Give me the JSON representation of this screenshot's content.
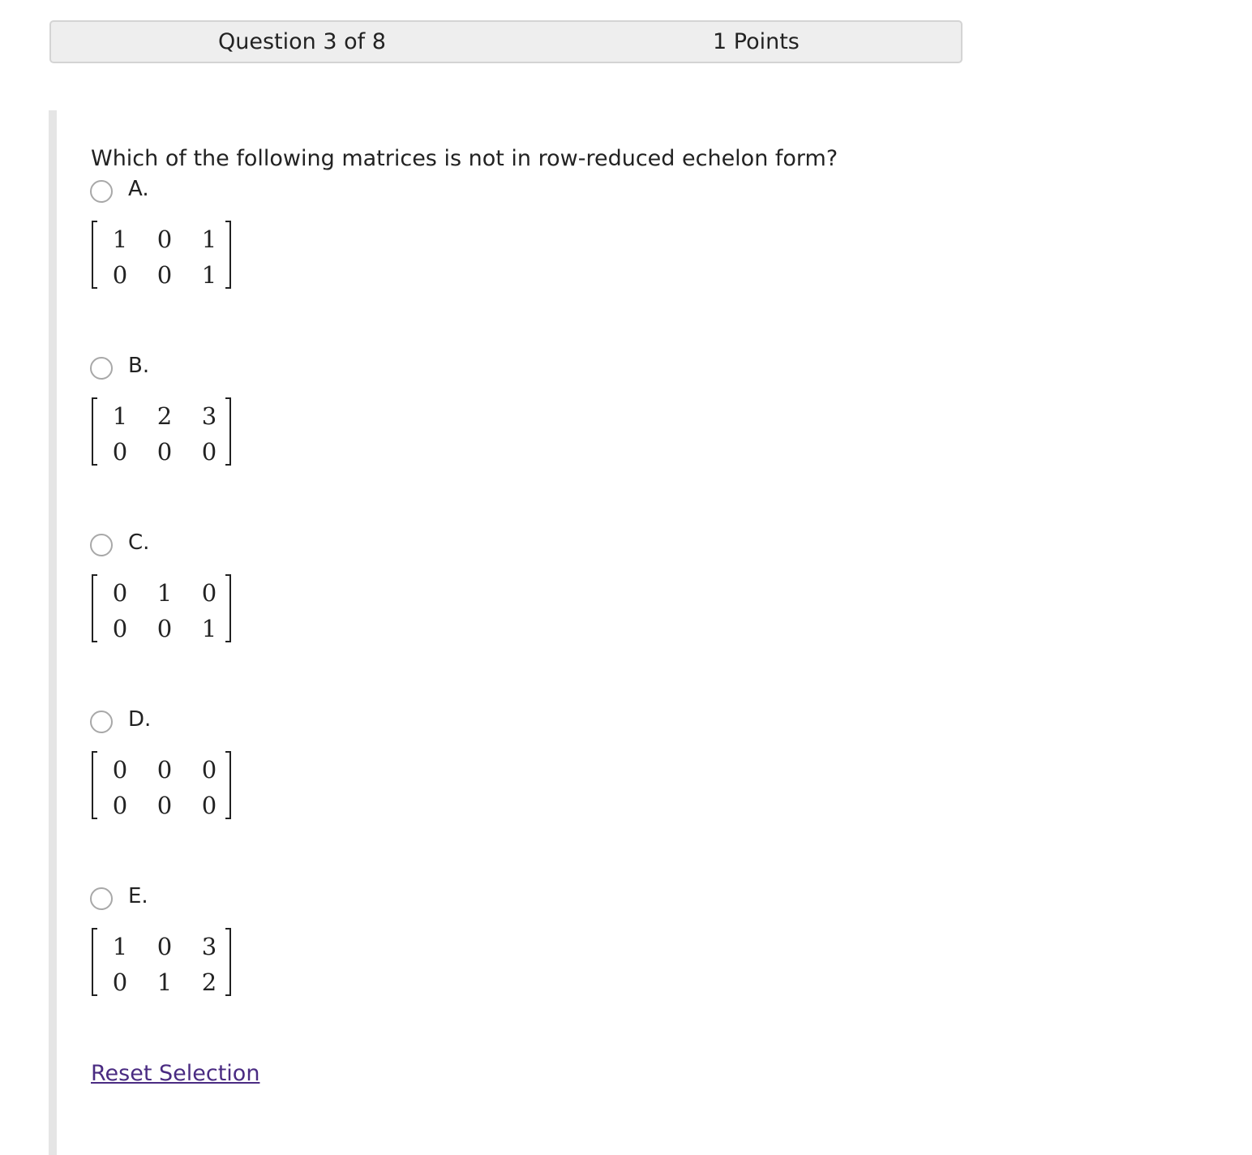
{
  "header": {
    "question_label": "Question 3 of 8",
    "points_label": "1 Points"
  },
  "question": {
    "text": "Which of the following matrices is not in row-reduced echelon form?"
  },
  "options": [
    {
      "label": "A.",
      "selected": false,
      "matrix": [
        [
          "1",
          "0",
          "1"
        ],
        [
          "0",
          "0",
          "1"
        ]
      ]
    },
    {
      "label": "B.",
      "selected": false,
      "matrix": [
        [
          "1",
          "2",
          "3"
        ],
        [
          "0",
          "0",
          "0"
        ]
      ]
    },
    {
      "label": "C.",
      "selected": false,
      "matrix": [
        [
          "0",
          "1",
          "0"
        ],
        [
          "0",
          "0",
          "1"
        ]
      ]
    },
    {
      "label": "D.",
      "selected": false,
      "matrix": [
        [
          "0",
          "0",
          "0"
        ],
        [
          "0",
          "0",
          "0"
        ]
      ]
    },
    {
      "label": "E.",
      "selected": false,
      "matrix": [
        [
          "1",
          "0",
          "3"
        ],
        [
          "0",
          "1",
          "2"
        ]
      ]
    }
  ],
  "reset_label": "Reset Selection",
  "colors": {
    "link": "#4a2b82",
    "header_bg": "#eeeeee",
    "side_bar": "#e5e5e5"
  }
}
